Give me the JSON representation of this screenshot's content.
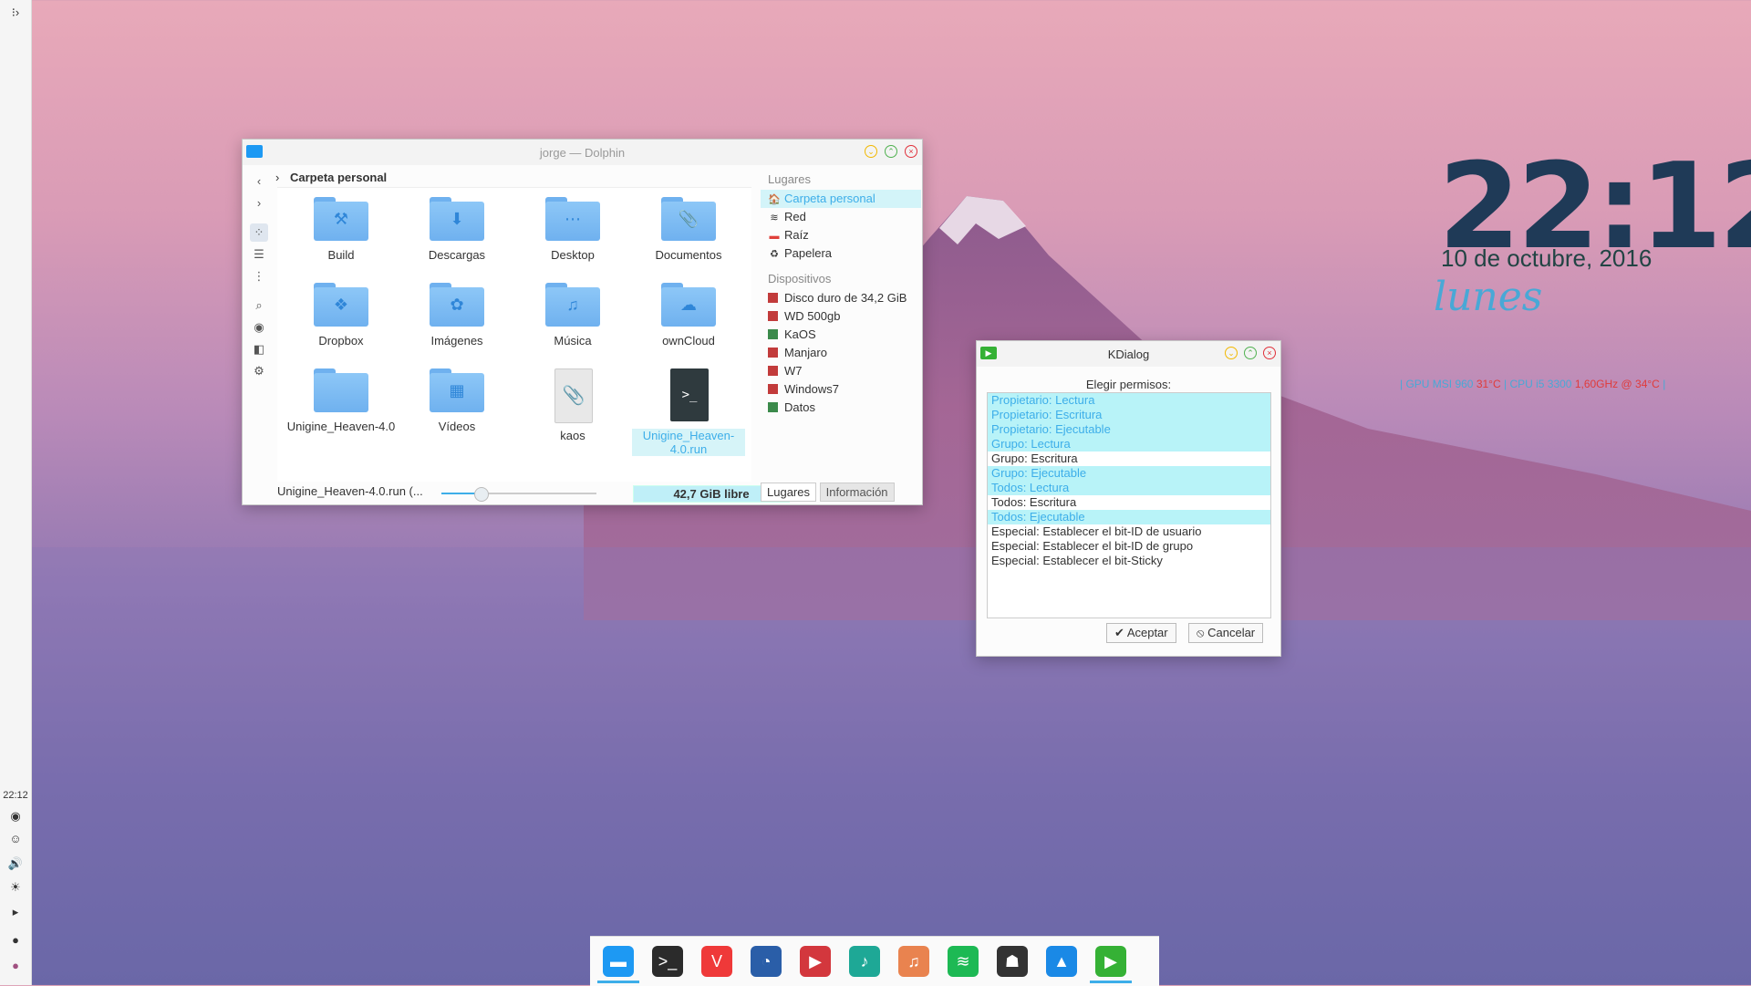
{
  "left_panel": {
    "clock": "22:12"
  },
  "dolphin": {
    "title": "jorge — Dolphin",
    "breadcrumb": "Carpeta personal",
    "files": [
      {
        "label": "Build",
        "icon": "hammer-icon",
        "glyph": "⚒"
      },
      {
        "label": "Descargas",
        "icon": "download-icon",
        "glyph": "⬇"
      },
      {
        "label": "Desktop",
        "icon": "desktop-icon",
        "glyph": "⋯"
      },
      {
        "label": "Documentos",
        "icon": "paperclip-icon",
        "glyph": "📎"
      },
      {
        "label": "Dropbox",
        "icon": "dropbox-icon",
        "glyph": "❖"
      },
      {
        "label": "Imágenes",
        "icon": "image-icon",
        "glyph": "✿"
      },
      {
        "label": "Música",
        "icon": "music-icon",
        "glyph": "♫"
      },
      {
        "label": "ownCloud",
        "icon": "cloud-icon",
        "glyph": "☁"
      },
      {
        "label": "Unigine_Heaven-4.0",
        "icon": "folder-icon",
        "glyph": ""
      },
      {
        "label": "Vídeos",
        "icon": "video-icon",
        "glyph": "▦"
      },
      {
        "label": "kaos",
        "icon": "paperclip-file-icon",
        "glyph": "📎"
      },
      {
        "label": "Unigine_Heaven-4.0.run",
        "icon": "terminal-icon",
        "glyph": ">_"
      }
    ],
    "status_filename": "Unigine_Heaven-4.0.run (...",
    "zoom_level": 0.25,
    "free_space": "42,7 GiB libre",
    "places_header": "Lugares",
    "places": [
      "Carpeta personal",
      "Red",
      "Raíz",
      "Papelera"
    ],
    "devices_header": "Dispositivos",
    "devices": [
      "Disco duro de 34,2 GiB",
      "WD 500gb",
      "KaOS",
      "Manjaro",
      "W7",
      "Windows7",
      "Datos"
    ],
    "tabs": [
      "Lugares",
      "Información"
    ]
  },
  "kdialog": {
    "title": "KDialog",
    "subtitle": "Elegir permisos:",
    "items": [
      {
        "label": "Propietario: Lectura",
        "selected": true
      },
      {
        "label": "Propietario: Escritura",
        "selected": true
      },
      {
        "label": "Propietario: Ejecutable",
        "selected": true
      },
      {
        "label": "Grupo: Lectura",
        "selected": true
      },
      {
        "label": "Grupo: Escritura",
        "selected": false
      },
      {
        "label": "Grupo: Ejecutable",
        "selected": true
      },
      {
        "label": "Todos: Lectura",
        "selected": true
      },
      {
        "label": "Todos: Escritura",
        "selected": false
      },
      {
        "label": "Todos: Ejecutable",
        "selected": true
      },
      {
        "label": "Especial: Establecer el bit-ID de usuario",
        "selected": false
      },
      {
        "label": "Especial: Establecer el bit-ID de grupo",
        "selected": false
      },
      {
        "label": "Especial: Establecer el bit-Sticky",
        "selected": false
      }
    ],
    "accept": "Aceptar",
    "cancel": "Cancelar"
  },
  "desktop_clock": {
    "time": "22:12",
    "date": "10 de octubre, 2016",
    "day": "lunes",
    "sys_gpu": "GPU MSI 960",
    "sys_gpu_temp": "31°C",
    "sys_cpu": "CPU i5 3300",
    "sys_cpu_temp": "1,60GHz @ 34°C"
  },
  "dock": {
    "apps": [
      {
        "name": "dolphin-icon",
        "color": "#1d99f3",
        "glyph": "▬"
      },
      {
        "name": "terminal-icon",
        "color": "#2b2b2b",
        "glyph": ">_"
      },
      {
        "name": "vivaldi-icon",
        "color": "#ef3939",
        "glyph": "V"
      },
      {
        "name": "browser-icon",
        "color": "#2a5ea8",
        "glyph": "◔"
      },
      {
        "name": "media-player-icon",
        "color": "#d3373d",
        "glyph": "▶"
      },
      {
        "name": "music-note-icon",
        "color": "#1ea896",
        "glyph": "♪"
      },
      {
        "name": "itunes-icon",
        "color": "#e9834f",
        "glyph": "♫"
      },
      {
        "name": "spotify-icon",
        "color": "#1db954",
        "glyph": "≋"
      },
      {
        "name": "inkscape-icon",
        "color": "#333333",
        "glyph": "☗"
      },
      {
        "name": "kaos-icon",
        "color": "#1a89e6",
        "glyph": "▲"
      },
      {
        "name": "kdialog-icon",
        "color": "#35b135",
        "glyph": "▶"
      }
    ]
  }
}
